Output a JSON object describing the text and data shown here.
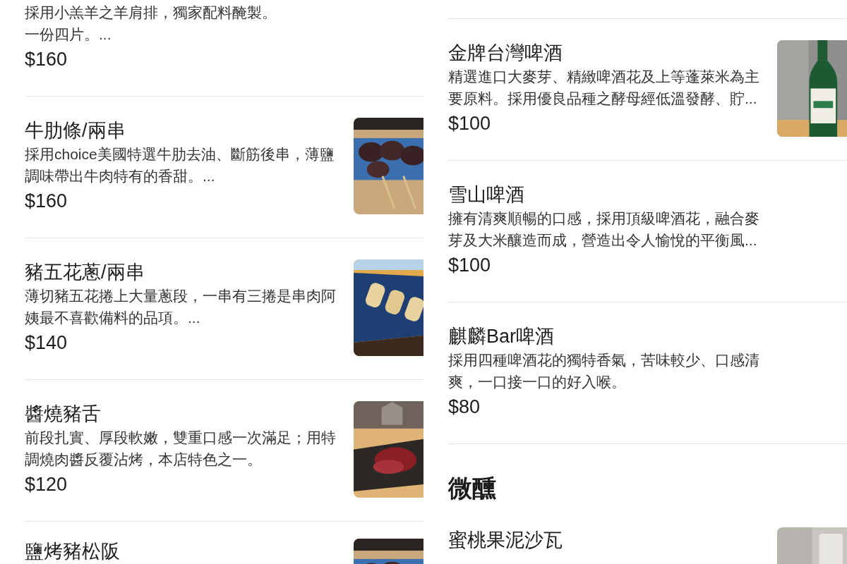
{
  "columns": [
    {
      "top_divider": false,
      "entries": [
        {
          "kind": "item",
          "description": [
            "採用小羔羊之羊肩排，獨家配料醃製。",
            "一份四片。..."
          ],
          "price": "$160",
          "photo": false
        },
        {
          "kind": "item",
          "title": "牛肋條/兩串",
          "description": [
            "採用choice美國特選牛肋去油、斷筋後串，薄鹽",
            "調味帶出牛肉特有的香甜。..."
          ],
          "price": "$160",
          "photo": true
        },
        {
          "kind": "item",
          "title": "豬五花蔥/兩串",
          "description": [
            "薄切豬五花捲上大量蔥段，一串有三捲是串肉阿",
            "姨最不喜歡備料的品項。..."
          ],
          "price": "$140",
          "photo": true
        },
        {
          "kind": "item",
          "title": "醬燒豬舌",
          "description": [
            "前段扎實、厚段軟嫩，雙重口感一次滿足；用特",
            "調燒肉醬反覆沾烤，本店特色之一。"
          ],
          "price": "$120",
          "photo": true
        },
        {
          "kind": "item",
          "title": "鹽烤豬松阪",
          "photo": true
        }
      ]
    },
    {
      "top_divider": true,
      "entries": [
        {
          "kind": "item",
          "title": "金牌台灣啤酒",
          "description": [
            "精選進口大麥芽、精緻啤酒花及上等蓬萊米為主",
            "要原料。採用優良品種之酵母經低溫發酵、貯..."
          ],
          "price": "$100",
          "photo": true
        },
        {
          "kind": "item",
          "title": "雪山啤酒",
          "description": [
            "擁有清爽順暢的口感，採用頂級啤酒花，融合麥",
            "芽及大米釀造而成，營造出令人愉悅的平衡風..."
          ],
          "price": "$100",
          "photo": false
        },
        {
          "kind": "item",
          "title": "麒麟Bar啤酒",
          "description": [
            "採用四種啤酒花的獨特香氣，苦味較少、口感清",
            "爽，一口接一口的好入喉。"
          ],
          "price": "$80",
          "photo": false
        },
        {
          "kind": "heading",
          "text": "微醺"
        },
        {
          "kind": "item",
          "title": "蜜桃果泥沙瓦",
          "photo": true
        }
      ]
    }
  ]
}
